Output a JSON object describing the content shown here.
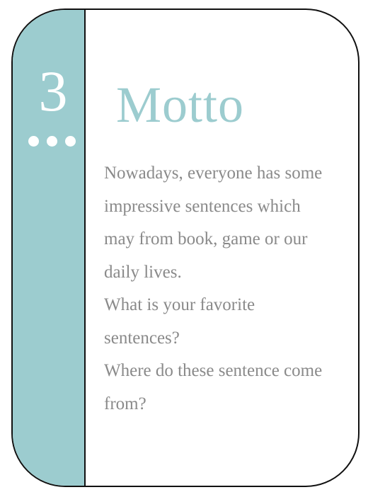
{
  "card": {
    "number": "3",
    "title": "Motto",
    "lines": [
      "Nowadays, everyone has some",
      "impressive sentences which",
      "may from book, game or our",
      "daily lives.",
      "What is your favorite",
      "sentences?",
      "Where do these sentence come",
      "from?"
    ]
  },
  "colors": {
    "accent": "#9ccccf",
    "text": "#8a8a8a",
    "border": "#111111"
  }
}
